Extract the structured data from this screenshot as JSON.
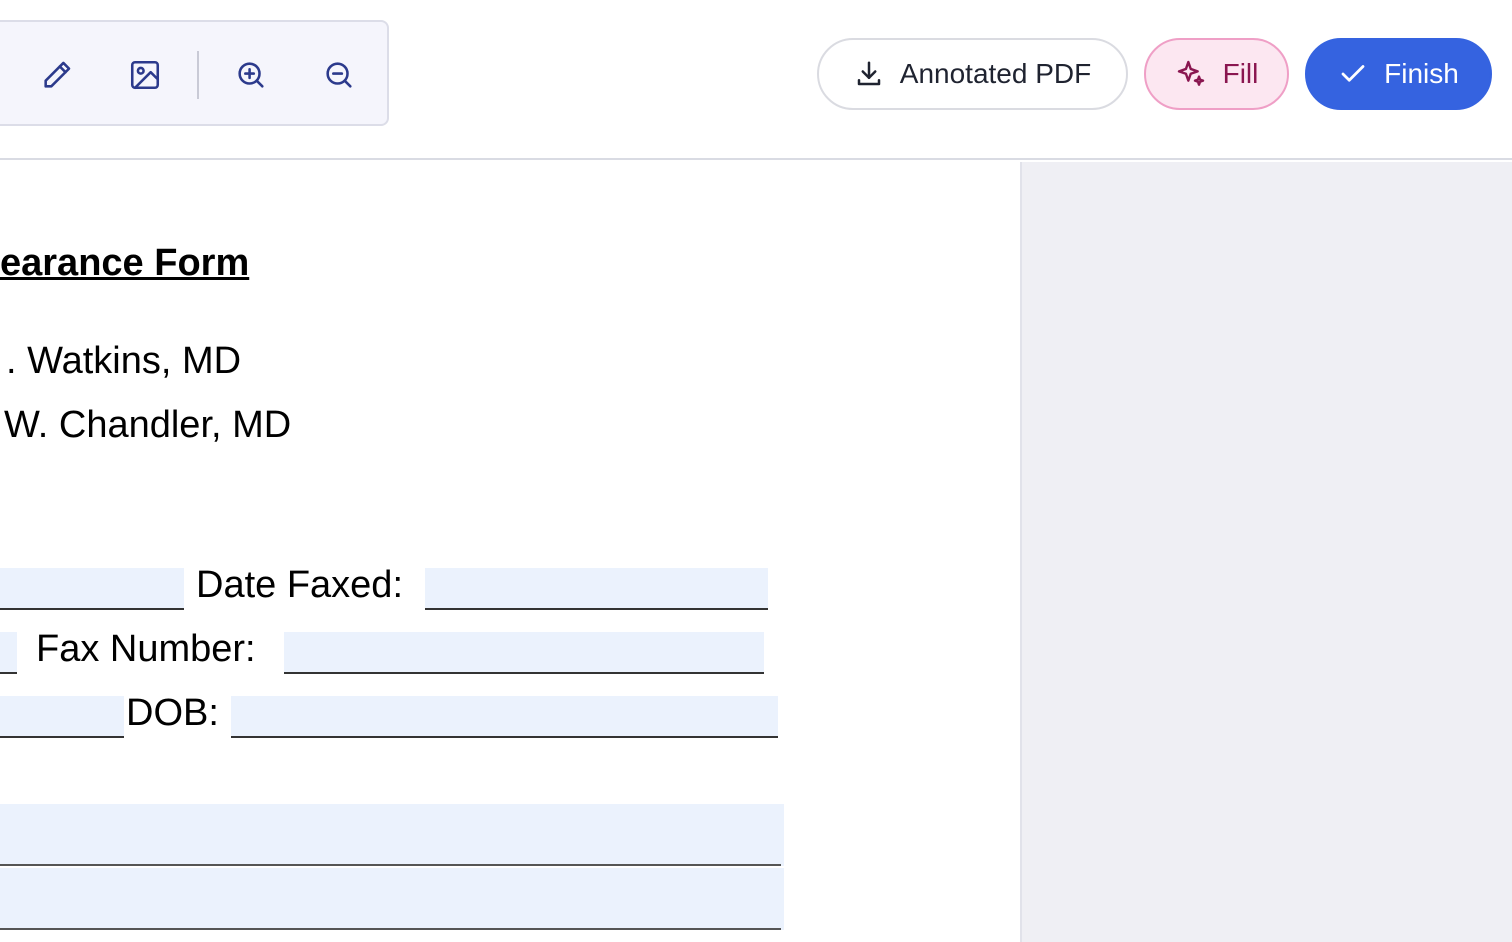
{
  "toolbar": {
    "tools": [
      {
        "icon": "pencil-icon"
      },
      {
        "icon": "image-icon"
      },
      {
        "icon": "zoom-in-icon"
      },
      {
        "icon": "zoom-out-icon"
      }
    ]
  },
  "actions": {
    "annotated_pdf_label": "Annotated PDF",
    "fill_label": "Fill",
    "finish_label": "Finish"
  },
  "document": {
    "title": "earance Form",
    "line1": ". Watkins, MD",
    "line2": "W. Chandler, MD",
    "date_faxed_label": "Date Faxed:",
    "fax_number_label": "Fax Number:",
    "dob_label": "DOB:",
    "partial_line_3": "______"
  },
  "colors": {
    "accent": "#3563e0",
    "fill_pink": "#fce7f1",
    "field_bg": "#ebf2fd",
    "side_bg": "#efeff4"
  }
}
